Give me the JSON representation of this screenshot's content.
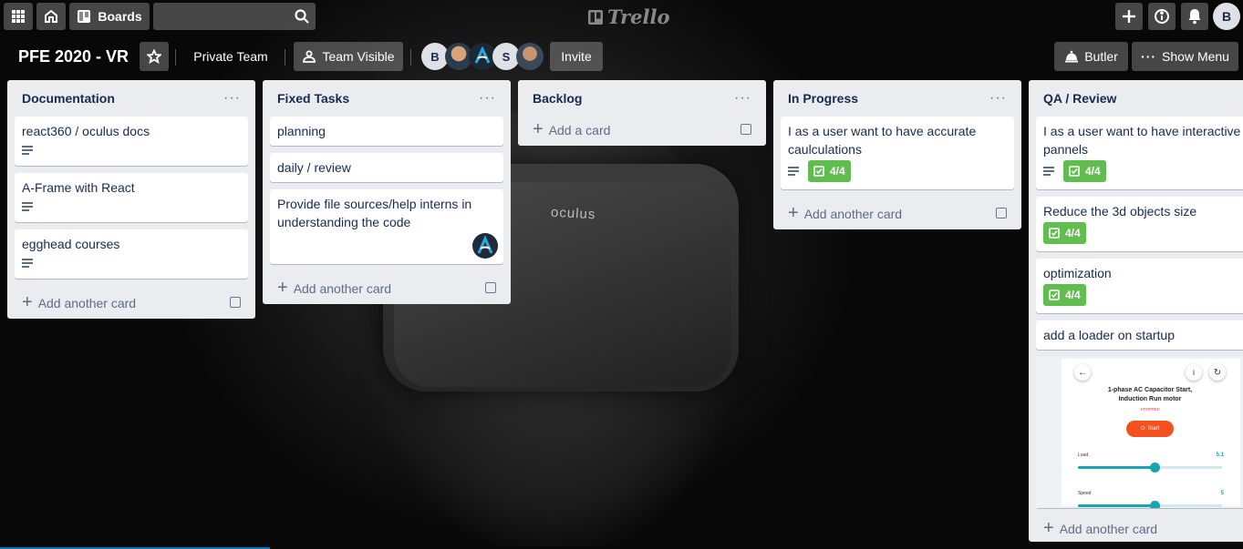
{
  "topbar": {
    "boards_label": "Boards",
    "search_value": "",
    "logo_text": "Trello",
    "user_initial": "B"
  },
  "board": {
    "title": "PFE 2020 - VR",
    "team_label": "Private Team",
    "visibility_label": "Team Visible",
    "members": [
      {
        "initial": "B"
      },
      {
        "initial": ""
      },
      {
        "initial": ""
      },
      {
        "initial": "S"
      },
      {
        "initial": ""
      }
    ],
    "invite_label": "Invite",
    "butler_label": "Butler",
    "menu_label": "Show Menu"
  },
  "add_card_label": "Add another card",
  "lists": [
    {
      "title": "Documentation",
      "cards": [
        {
          "title": "react360 / oculus docs",
          "has_desc": true
        },
        {
          "title": "A-Frame with React",
          "has_desc": true
        },
        {
          "title": "egghead courses",
          "has_desc": true
        }
      ]
    },
    {
      "title": "Fixed Tasks",
      "cards": [
        {
          "title": "planning"
        },
        {
          "title": "daily / review"
        },
        {
          "title": "Provide file sources/help interns in understanding the code"
        }
      ]
    },
    {
      "title": "Backlog",
      "add_label": "Add a card",
      "cards": []
    },
    {
      "title": "In Progress",
      "cards": [
        {
          "title": "I as a user want to have accurate caulculations",
          "has_desc": true,
          "checklist": "4/4"
        }
      ]
    },
    {
      "title": "QA / Review",
      "cards": [
        {
          "title": "I as a user want to have interactive pannels",
          "has_desc": true,
          "checklist": "4/4"
        },
        {
          "title": "Reduce the 3d objects size",
          "checklist": "4/4"
        },
        {
          "title": "optimization",
          "checklist": "4/4"
        },
        {
          "title": "add a loader on startup"
        }
      ]
    }
  ],
  "cover": {
    "title_line1": "1-phase AC Capacitor Start,",
    "title_line2": "Induction Run motor",
    "status": "STOPPED",
    "button": "Start",
    "load_label": "Load",
    "load_value": "5.1",
    "speed_label": "Speed",
    "speed_value": "5",
    "load_level": 0.53,
    "speed_level": 0.53
  },
  "colors": {
    "accent_green": "#61bd4f",
    "list_bg": "#ebecf0",
    "slider": "#17a5b6",
    "start_btn": "#f4511e"
  }
}
